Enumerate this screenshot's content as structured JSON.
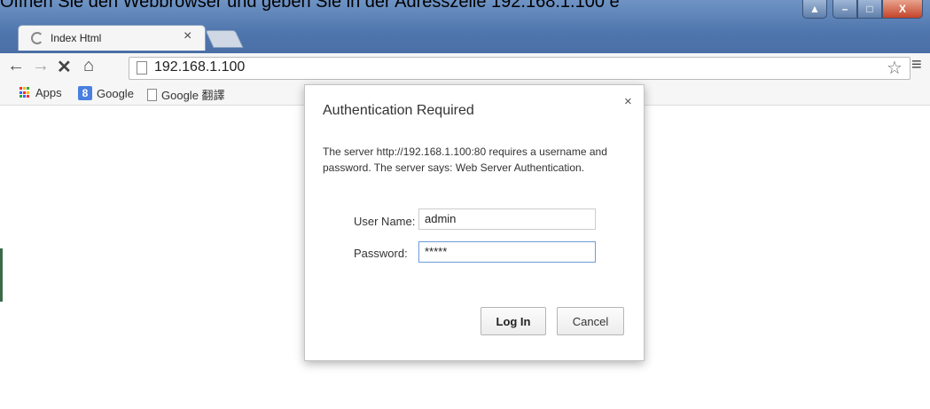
{
  "caption": "Öffnen Sie den Webbrowser und geben Sie in der Adresszeile 192.168.1.100 e",
  "tab": {
    "title": "Index Html",
    "close": "×"
  },
  "window_controls": {
    "user": "▲",
    "minimize": "–",
    "maximize": "□",
    "close": "X"
  },
  "toolbar": {
    "back": "←",
    "forward": "→",
    "stop": "✕",
    "home": "⌂",
    "url": "192.168.1.100",
    "star": "☆",
    "menu": "≡"
  },
  "bookmarks": [
    {
      "label": "Apps"
    },
    {
      "label": "Google"
    },
    {
      "label": "Google 翻譯"
    }
  ],
  "dialog": {
    "title": "Authentication Required",
    "close": "×",
    "message": "The server http://192.168.1.100:80 requires a username and password. The server says: Web Server Authentication.",
    "username_label": "User Name:",
    "username_value": "admin",
    "password_label": "Password:",
    "password_value": "*****",
    "login_label": "Log In",
    "cancel_label": "Cancel"
  },
  "colors": {
    "titlebar": "#5579ae",
    "accent": "#6f9bd9",
    "close": "#c4442a"
  }
}
